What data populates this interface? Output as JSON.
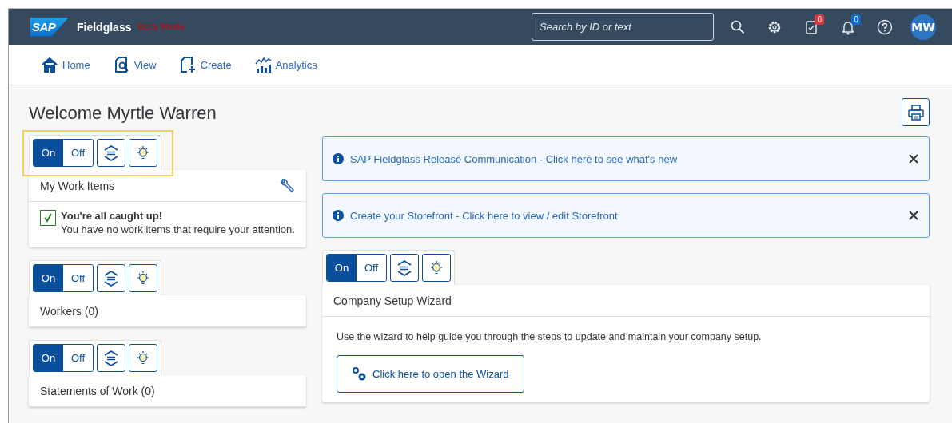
{
  "header": {
    "logo": "SAP",
    "product": "Fieldglass",
    "mode": "Beta Mode",
    "search": {
      "placeholder": "Search by ID or text"
    },
    "task_badge": "0",
    "alert_badge": "0",
    "avatar": "MW"
  },
  "nav": [
    {
      "kind": "home",
      "label": "Home"
    },
    {
      "kind": "view",
      "label": "View"
    },
    {
      "kind": "create",
      "label": "Create"
    },
    {
      "kind": "analytics",
      "label": "Analytics"
    }
  ],
  "welcome": "Welcome Myrtle Warren",
  "left_widgets": [
    {
      "highlighted": true,
      "toggle": [
        {
          "label": "On",
          "selected": true
        },
        {
          "label": "Off",
          "selected": false
        }
      ],
      "title": "My Work Items",
      "tool": true,
      "body": {
        "kind": "status",
        "heading": "You're all caught up!",
        "text": "You have no work items that require your attention."
      }
    },
    {
      "highlighted": false,
      "toggle": [
        {
          "label": "On",
          "selected": true
        },
        {
          "label": "Off",
          "selected": false
        }
      ],
      "title": "Workers (0)",
      "tool": false
    },
    {
      "highlighted": false,
      "toggle": [
        {
          "label": "On",
          "selected": true
        },
        {
          "label": "Off",
          "selected": false
        }
      ],
      "title": "Statements of Work (0)",
      "tool": false
    }
  ],
  "notices": [
    {
      "text": "SAP Fieldglass Release Communication - Click here to see what's new"
    },
    {
      "text": "Create your Storefront - Click here to view / edit Storefront"
    }
  ],
  "right_widgets": [
    {
      "highlighted": false,
      "toggle": [
        {
          "label": "On",
          "selected": true
        },
        {
          "label": "Off",
          "selected": false
        }
      ],
      "title": "Company Setup Wizard",
      "tool": false,
      "body": {
        "kind": "wizard",
        "text": "Use the wizard to help guide you through the steps to update and maintain your company setup.",
        "button": "Click here to open the Wizard"
      }
    }
  ]
}
